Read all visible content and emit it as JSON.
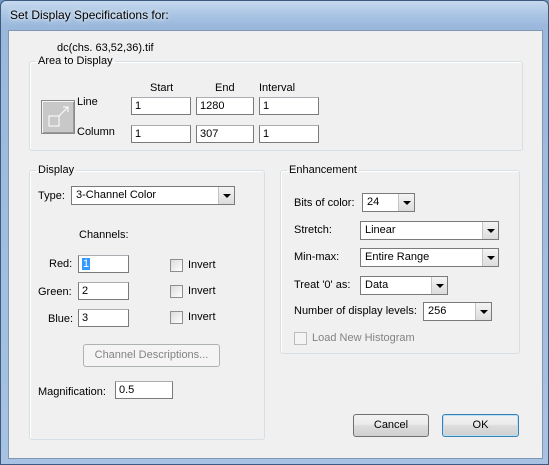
{
  "window": {
    "title": "Set Display Specifications for:"
  },
  "filename": "dc(chs. 63,52,36).tif",
  "area": {
    "legend": "Area to Display",
    "headers": {
      "start": "Start",
      "end": "End",
      "interval": "Interval"
    },
    "line": {
      "label": "Line",
      "start": "1",
      "end": "1280",
      "interval": "1"
    },
    "column": {
      "label": "Column",
      "start": "1",
      "end": "307",
      "interval": "1"
    },
    "icon": "area-selection-icon"
  },
  "display": {
    "legend": "Display",
    "type_label": "Type:",
    "type_value": "3-Channel Color",
    "channels_label": "Channels:",
    "red": {
      "label": "Red:",
      "value": "1"
    },
    "green": {
      "label": "Green:",
      "value": "2"
    },
    "blue": {
      "label": "Blue:",
      "value": "3"
    },
    "invert_label": "Invert",
    "channel_desc_button": "Channel Descriptions...",
    "magnification_label": "Magnification:",
    "magnification_value": "0.5"
  },
  "enhancement": {
    "legend": "Enhancement",
    "bits_label": "Bits of color:",
    "bits_value": "24",
    "stretch_label": "Stretch:",
    "stretch_value": "Linear",
    "minmax_label": "Min-max:",
    "minmax_value": "Entire Range",
    "treat_zero_label": "Treat '0' as:",
    "treat_zero_value": "Data",
    "levels_label": "Number of display levels:",
    "levels_value": "256",
    "load_histogram_label": "Load New Histogram"
  },
  "buttons": {
    "cancel": "Cancel",
    "ok": "OK"
  }
}
